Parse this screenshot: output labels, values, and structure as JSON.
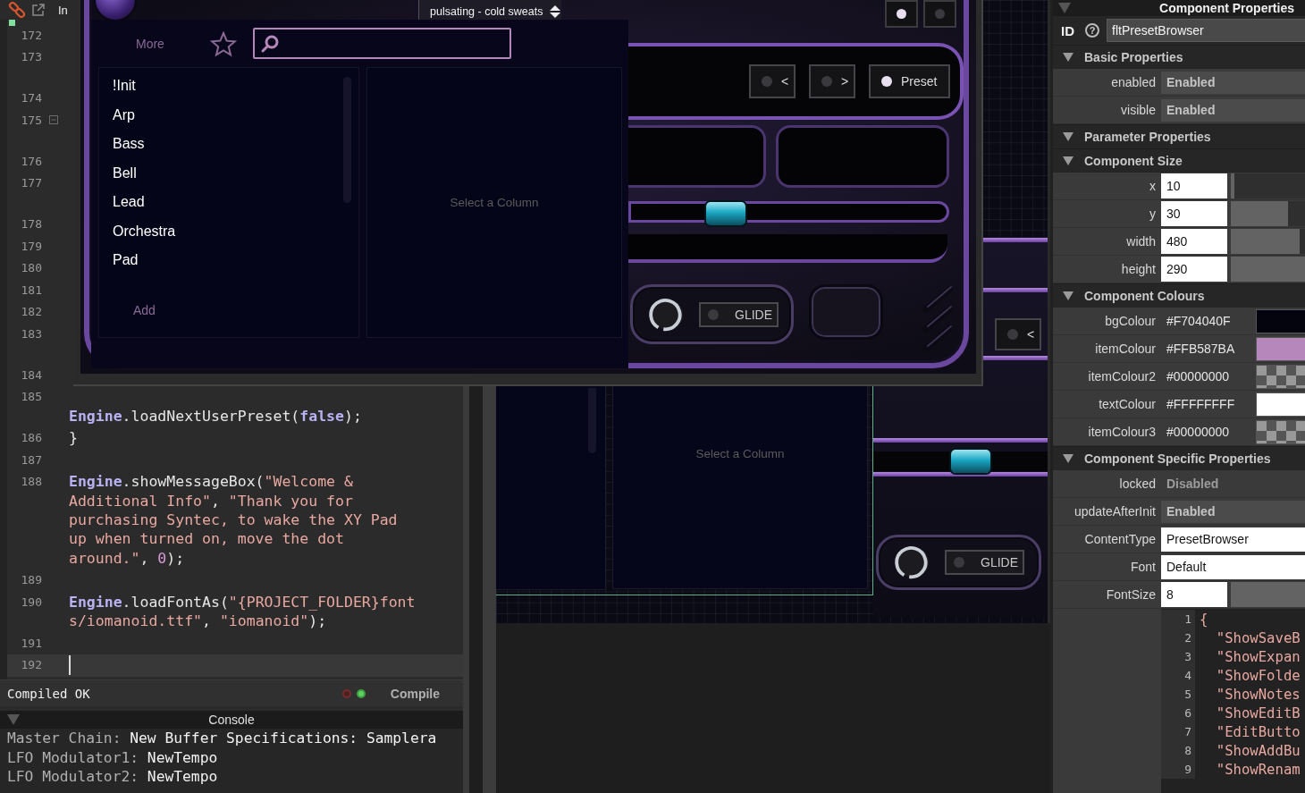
{
  "editor": {
    "tab_label": "In",
    "lines": [
      {
        "number": "172",
        "wrapped": false,
        "fold": false,
        "current": false
      },
      {
        "number": "173",
        "wrapped": true,
        "fold": false,
        "current": false
      },
      {
        "number": "174",
        "wrapped": false,
        "fold": false,
        "current": false
      },
      {
        "number": "175",
        "wrapped": true,
        "fold": true,
        "current": false
      },
      {
        "number": "176",
        "wrapped": false,
        "fold": false,
        "current": false
      },
      {
        "number": "177",
        "wrapped": true,
        "fold": false,
        "current": false
      },
      {
        "number": "178",
        "wrapped": false,
        "fold": false,
        "current": false
      },
      {
        "number": "179",
        "wrapped": false,
        "fold": false,
        "current": false
      },
      {
        "number": "180",
        "wrapped": false,
        "fold": false,
        "current": false
      },
      {
        "number": "181",
        "wrapped": false,
        "fold": false,
        "current": false
      },
      {
        "number": "182",
        "wrapped": false,
        "fold": false,
        "current": false
      },
      {
        "number": "183",
        "wrapped": true,
        "fold": false,
        "current": false
      },
      {
        "number": "184",
        "wrapped": false,
        "fold": false,
        "current": false
      },
      {
        "number": "185",
        "wrapped": true,
        "fold": false,
        "current": false,
        "tokens": [
          {
            "kind": "class",
            "text": "Engine"
          },
          {
            "kind": "plain",
            "text": ".loadNextUserPreset("
          },
          {
            "kind": "keyword",
            "text": "false"
          },
          {
            "kind": "plain",
            "text": ");"
          }
        ]
      },
      {
        "number": "186",
        "wrapped": false,
        "fold": false,
        "current": false,
        "tokens": [
          {
            "kind": "plain",
            "text": "}"
          }
        ]
      },
      {
        "number": "187",
        "wrapped": false,
        "fold": false,
        "current": false
      },
      {
        "number": "188",
        "wrapped": false,
        "fold": false,
        "current": false,
        "tokens": [
          {
            "kind": "class",
            "text": "Engine"
          },
          {
            "kind": "plain",
            "text": ".showMessageBox("
          },
          {
            "kind": "string",
            "text": "\"Welcome & Additional Info\""
          },
          {
            "kind": "plain",
            "text": ", "
          },
          {
            "kind": "string",
            "text": "\"Thank you for purchasing Syntec, to wake the XY Pad up when turned on, move the dot around.\""
          },
          {
            "kind": "plain",
            "text": ", "
          },
          {
            "kind": "number",
            "text": "0"
          },
          {
            "kind": "plain",
            "text": ");"
          }
        ]
      },
      {
        "number": "189",
        "wrapped": false,
        "fold": false,
        "current": false
      },
      {
        "number": "190",
        "wrapped": false,
        "fold": false,
        "current": false,
        "tokens": [
          {
            "kind": "class",
            "text": "Engine"
          },
          {
            "kind": "plain",
            "text": ".loadFontAs("
          },
          {
            "kind": "string",
            "text": "\"{PROJECT_FOLDER}fonts/iomanoid.ttf\""
          },
          {
            "kind": "plain",
            "text": ", "
          },
          {
            "kind": "string",
            "text": "\"iomanoid\""
          },
          {
            "kind": "plain",
            "text": ");"
          }
        ]
      },
      {
        "number": "191",
        "wrapped": false,
        "fold": false,
        "current": false
      },
      {
        "number": "192",
        "wrapped": false,
        "fold": false,
        "current": true
      }
    ],
    "status": {
      "text": "Compiled OK",
      "button": "Compile"
    }
  },
  "console": {
    "title": "Console",
    "lines": [
      {
        "source": "Master Chain:",
        "message": " New Buffer Specifications: Samplera"
      },
      {
        "source": "LFO Modulator1:",
        "message": " NewTempo"
      },
      {
        "source": "LFO Modulator2:",
        "message": " NewTempo"
      }
    ]
  },
  "preview": {
    "preset_name": "pulsating - cold sweats",
    "top_buttons": [
      {
        "lit": true
      },
      {
        "lit": false
      }
    ],
    "browser": {
      "more": "More",
      "add": "Add",
      "empty_column": "Select a Column",
      "categories": [
        {
          "label": "!Init",
          "selected": false
        },
        {
          "label": "Arp",
          "selected": false
        },
        {
          "label": "Bass",
          "selected": false
        },
        {
          "label": "Bell",
          "selected": false
        },
        {
          "label": "Lead",
          "selected": false
        },
        {
          "label": "Orchestra",
          "selected": false
        },
        {
          "label": "Pad",
          "selected": false
        }
      ]
    },
    "nav_buttons": [
      {
        "label": "<",
        "lit": false
      },
      {
        "label": ">",
        "lit": false
      },
      {
        "label": "Preset",
        "lit": true
      }
    ],
    "slider": {
      "level": 0.3
    },
    "glide": {
      "label": "GLIDE",
      "lit": false
    }
  },
  "canvas": {
    "empty_column": "Select a Column",
    "slider": {
      "level": 0.56
    },
    "glide": {
      "label": "GLIDE",
      "lit": false
    },
    "back_button": {
      "label": "<",
      "lit": false
    }
  },
  "properties": {
    "title": "Component Properties",
    "id_label": "ID",
    "help": "?",
    "id_value": "fltPresetBrowser",
    "sections": [
      {
        "title": "Basic Properties",
        "expanded": true,
        "rows": [
          {
            "kind": "toggle",
            "label": "enabled",
            "value": "Enabled",
            "on": true
          },
          {
            "kind": "toggle",
            "label": "visible",
            "value": "Enabled",
            "on": true
          }
        ]
      },
      {
        "title": "Parameter Properties",
        "expanded": true
      },
      {
        "title": "Component Size",
        "expanded": true,
        "rows": [
          {
            "kind": "number",
            "label": "x",
            "value": "10",
            "level": 0.05
          },
          {
            "kind": "number",
            "label": "y",
            "value": "30",
            "level": 0.77
          },
          {
            "kind": "number",
            "label": "width",
            "value": "480",
            "level": 0.93
          },
          {
            "kind": "number",
            "label": "height",
            "value": "290",
            "level": 1
          }
        ]
      },
      {
        "title": "Component Colours",
        "expanded": true,
        "rows": [
          {
            "kind": "colour",
            "label": "bgColour",
            "value": "#F704040F",
            "color": "#04040f",
            "transparent": false
          },
          {
            "kind": "colour",
            "label": "itemColour",
            "value": "#FFB587BA",
            "color": "#b587ba",
            "transparent": false
          },
          {
            "kind": "colour",
            "label": "itemColour2",
            "value": "#00000000",
            "transparent": true
          },
          {
            "kind": "colour",
            "label": "textColour",
            "value": "#FFFFFFFF",
            "color": "#ffffff",
            "transparent": false
          },
          {
            "kind": "colour",
            "label": "itemColour3",
            "value": "#00000000",
            "transparent": true
          }
        ]
      },
      {
        "title": "Component Specific Properties",
        "expanded": true,
        "rows": [
          {
            "kind": "toggle",
            "label": "locked",
            "value": "Disabled",
            "on": false
          },
          {
            "kind": "toggle",
            "label": "updateAfterInit",
            "value": "Enabled",
            "on": true
          },
          {
            "kind": "text",
            "label": "ContentType",
            "value": "PresetBrowser"
          },
          {
            "kind": "text",
            "label": "Font",
            "value": "Default"
          },
          {
            "kind": "number",
            "label": "FontSize",
            "value": "8",
            "level": 1
          },
          {
            "kind": "json",
            "lines": [
              {
                "number": "1",
                "text": "{"
              },
              {
                "number": "2",
                "text": "  \"ShowSaveB"
              },
              {
                "number": "3",
                "text": "  \"ShowExpan"
              },
              {
                "number": "4",
                "text": "  \"ShowFolde"
              },
              {
                "number": "5",
                "text": "  \"ShowNotes"
              },
              {
                "number": "6",
                "text": "  \"ShowEditB"
              },
              {
                "number": "7",
                "text": "  \"EditButto"
              },
              {
                "number": "8",
                "text": "  \"ShowAddBu"
              },
              {
                "number": "9",
                "text": "  \"ShowRenam"
              }
            ]
          }
        ]
      }
    ]
  }
}
